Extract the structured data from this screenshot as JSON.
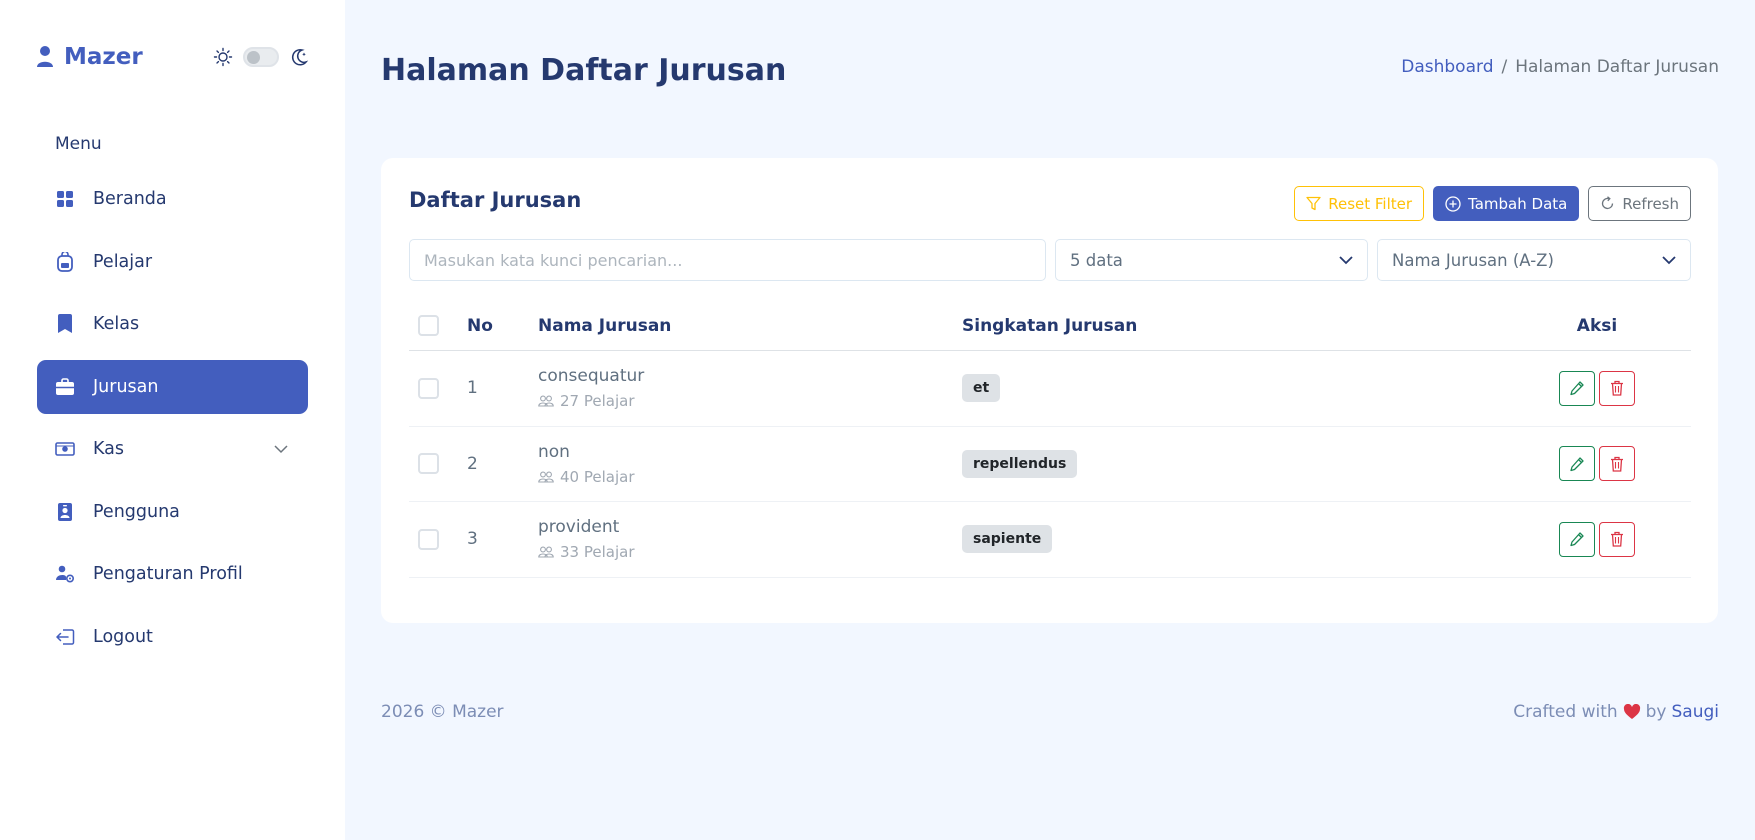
{
  "sidebar": {
    "brand": "Mazer",
    "menu_title": "Menu",
    "items": [
      {
        "label": "Beranda",
        "icon": "grid-icon"
      },
      {
        "label": "Pelajar",
        "icon": "backpack-icon"
      },
      {
        "label": "Kelas",
        "icon": "bookmark-icon"
      },
      {
        "label": "Jurusan",
        "icon": "briefcase-icon",
        "active": true
      },
      {
        "label": "Kas",
        "icon": "cash-icon",
        "has_submenu": true
      },
      {
        "label": "Pengguna",
        "icon": "person-badge-icon"
      },
      {
        "label": "Pengaturan Profil",
        "icon": "person-gear-icon"
      },
      {
        "label": "Logout",
        "icon": "box-arrow-left-icon"
      }
    ]
  },
  "header": {
    "title": "Halaman Daftar Jurusan",
    "breadcrumb": {
      "link": "Dashboard",
      "separator": "/",
      "current": "Halaman Daftar Jurusan"
    }
  },
  "card": {
    "title": "Daftar Jurusan",
    "buttons": {
      "reset": "Reset Filter",
      "add": "Tambah Data",
      "refresh": "Refresh"
    },
    "search": {
      "placeholder": "Masukan kata kunci pencarian...",
      "value": ""
    },
    "limit_select": "5 data",
    "sort_select": "Nama Jurusan (A-Z)"
  },
  "table": {
    "columns": {
      "no": "No",
      "name": "Nama Jurusan",
      "abbr": "Singkatan Jurusan",
      "action": "Aksi"
    },
    "rows": [
      {
        "no": "1",
        "name": "consequatur",
        "students": "27 Pelajar",
        "abbr": "et"
      },
      {
        "no": "2",
        "name": "non",
        "students": "40 Pelajar",
        "abbr": "repellendus"
      },
      {
        "no": "3",
        "name": "provident",
        "students": "33 Pelajar",
        "abbr": "sapiente"
      }
    ]
  },
  "footer": {
    "copyright": "2026 © Mazer",
    "crafted_prefix": "Crafted with",
    "crafted_by": "by",
    "author": "Saugi"
  },
  "colors": {
    "primary": "#435ebe",
    "warning": "#ffc107",
    "success": "#198754",
    "danger": "#dc3545",
    "background": "#f2f7ff"
  }
}
